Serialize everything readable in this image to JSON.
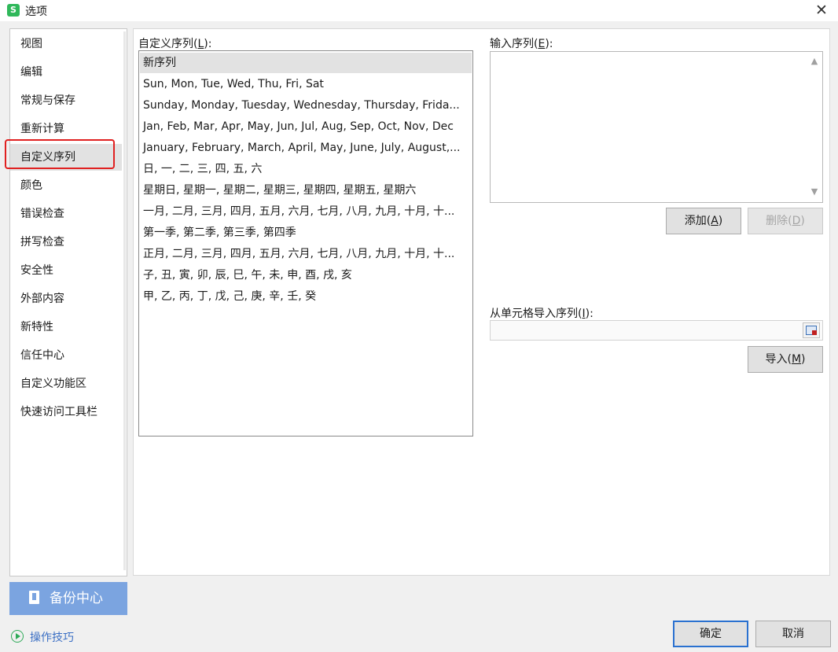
{
  "window": {
    "title": "选项",
    "app_icon_glyph": "S",
    "close_glyph": "✕"
  },
  "nav": {
    "items": [
      "视图",
      "编辑",
      "常规与保存",
      "重新计算",
      "自定义序列",
      "颜色",
      "错误检查",
      "拼写检查",
      "安全性",
      "外部内容",
      "新特性",
      "信任中心",
      "自定义功能区",
      "快速访问工具栏"
    ],
    "selected_index": 4,
    "highlight_color": "#e02020"
  },
  "backup": {
    "label": "备份中心",
    "icon": "backup-document-icon"
  },
  "tips": {
    "label": "操作技巧",
    "icon": "play-circle-icon"
  },
  "custom_list": {
    "label_text": "自定义序列(",
    "label_key": "L",
    "label_end": "):",
    "items": [
      "新序列",
      "Sun, Mon, Tue, Wed, Thu, Fri, Sat",
      "Sunday, Monday, Tuesday, Wednesday, Thursday, Frida...",
      "Jan, Feb, Mar, Apr, May, Jun, Jul, Aug, Sep, Oct, Nov, Dec",
      "January, February, March, April, May, June, July, August,...",
      "日, 一, 二, 三, 四, 五, 六",
      "星期日, 星期一, 星期二, 星期三, 星期四, 星期五, 星期六",
      "一月, 二月, 三月, 四月, 五月, 六月, 七月, 八月, 九月, 十月, 十...",
      "第一季, 第二季, 第三季, 第四季",
      "正月, 二月, 三月, 四月, 五月, 六月, 七月, 八月, 九月, 十月, 十...",
      "子, 丑, 寅, 卯, 辰, 巳, 午, 未, 申, 酉, 戌, 亥",
      "甲, 乙, 丙, 丁, 戊, 己, 庚, 辛, 壬, 癸"
    ],
    "selected_index": 0
  },
  "input_series": {
    "label_text": "输入序列(",
    "label_key": "E",
    "label_end": "):",
    "value": ""
  },
  "buttons": {
    "add": {
      "text": "添加(",
      "key": "A",
      "end": ")"
    },
    "delete": {
      "text": "删除(",
      "key": "D",
      "end": ")"
    },
    "import": {
      "text": "导入(",
      "key": "M",
      "end": ")"
    },
    "ok": "确定",
    "cancel": "取消"
  },
  "import_from_cells": {
    "label_text": "从单元格导入序列(",
    "label_key": "I",
    "label_end": "):",
    "value": ""
  }
}
